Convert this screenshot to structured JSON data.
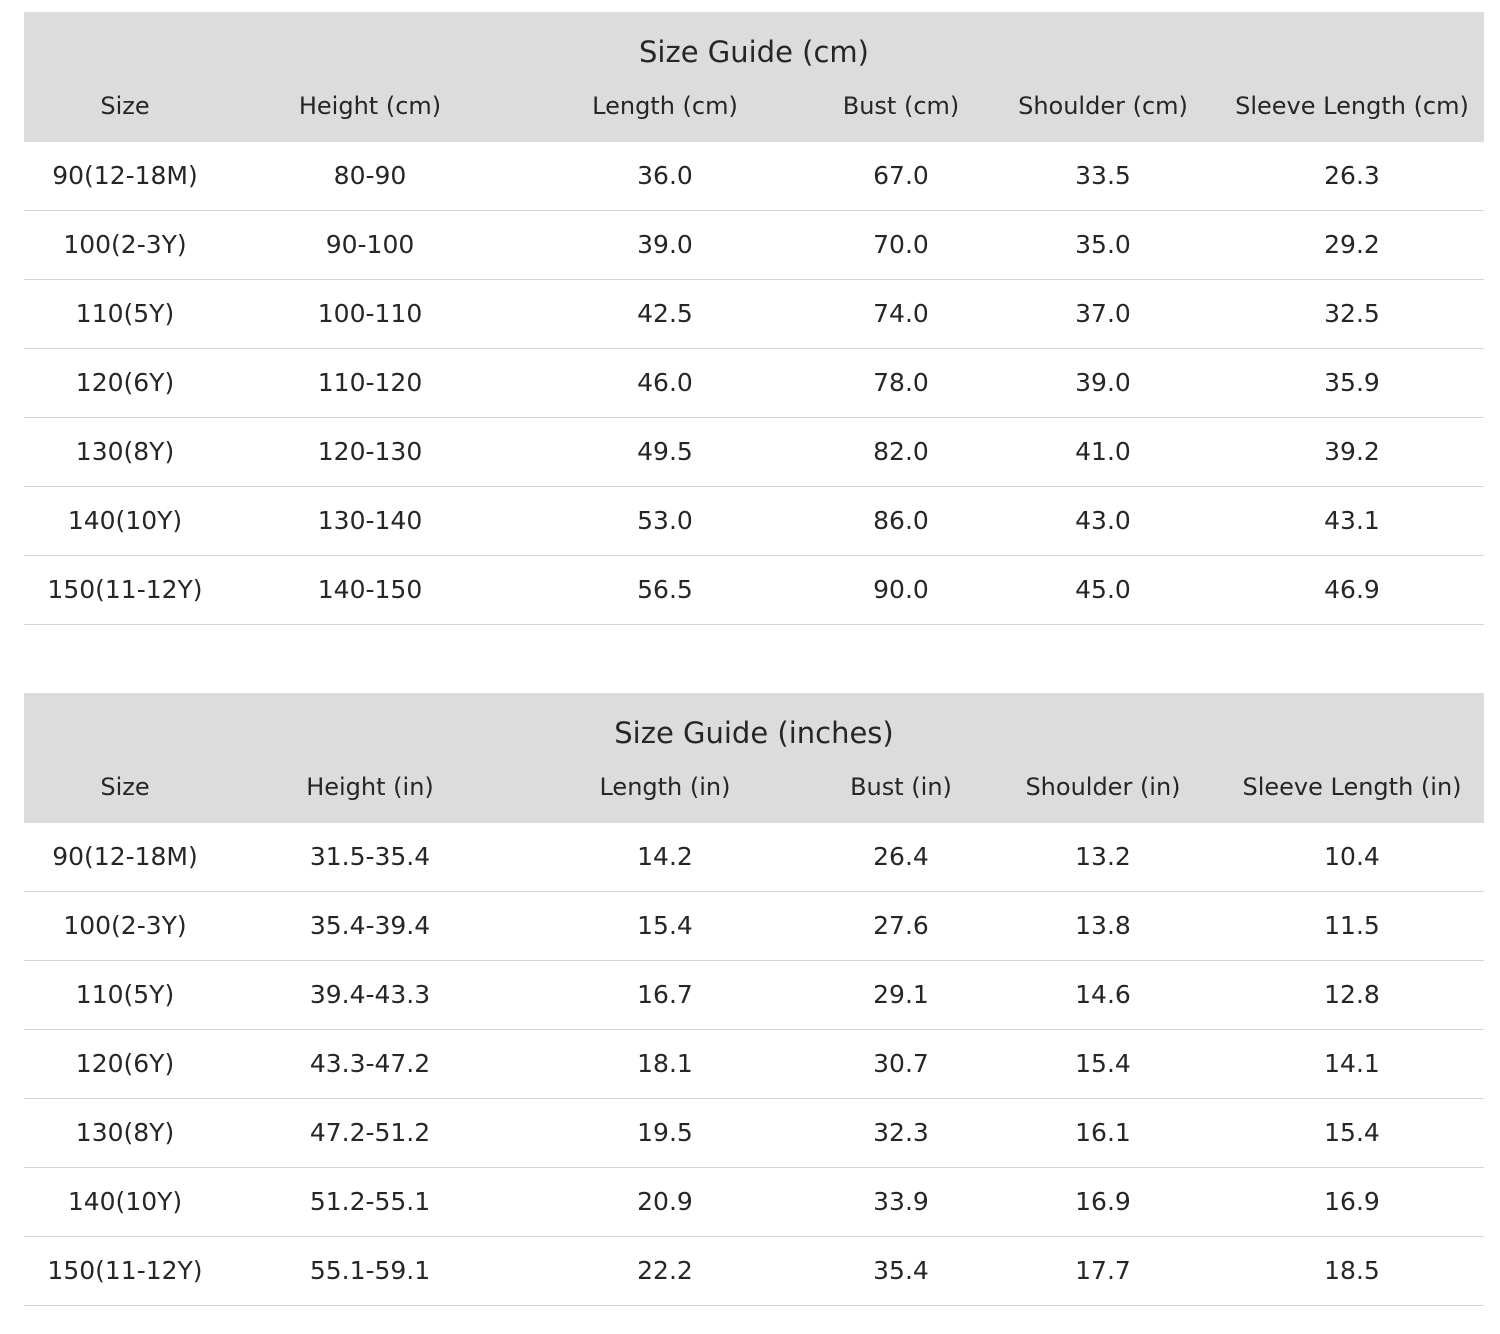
{
  "tables": [
    {
      "title": "Size Guide (cm)",
      "columns": [
        "Size",
        "Height (cm)",
        "Length (cm)",
        "Bust (cm)",
        "Shoulder (cm)",
        "Sleeve Length (cm)"
      ],
      "rows": [
        [
          "90(12-18M)",
          "80-90",
          "36.0",
          "67.0",
          "33.5",
          "26.3"
        ],
        [
          "100(2-3Y)",
          "90-100",
          "39.0",
          "70.0",
          "35.0",
          "29.2"
        ],
        [
          "110(5Y)",
          "100-110",
          "42.5",
          "74.0",
          "37.0",
          "32.5"
        ],
        [
          "120(6Y)",
          "110-120",
          "46.0",
          "78.0",
          "39.0",
          "35.9"
        ],
        [
          "130(8Y)",
          "120-130",
          "49.5",
          "82.0",
          "41.0",
          "39.2"
        ],
        [
          "140(10Y)",
          "130-140",
          "53.0",
          "86.0",
          "43.0",
          "43.1"
        ],
        [
          "150(11-12Y)",
          "140-150",
          "56.5",
          "90.0",
          "45.0",
          "46.9"
        ]
      ]
    },
    {
      "title": "Size Guide (inches)",
      "columns": [
        "Size",
        "Height (in)",
        "Length (in)",
        "Bust (in)",
        "Shoulder (in)",
        "Sleeve Length (in)"
      ],
      "rows": [
        [
          "90(12-18M)",
          "31.5-35.4",
          "14.2",
          "26.4",
          "13.2",
          "10.4"
        ],
        [
          "100(2-3Y)",
          "35.4-39.4",
          "15.4",
          "27.6",
          "13.8",
          "11.5"
        ],
        [
          "110(5Y)",
          "39.4-43.3",
          "16.7",
          "29.1",
          "14.6",
          "12.8"
        ],
        [
          "120(6Y)",
          "43.3-47.2",
          "18.1",
          "30.7",
          "15.4",
          "14.1"
        ],
        [
          "130(8Y)",
          "47.2-51.2",
          "19.5",
          "32.3",
          "16.1",
          "15.4"
        ],
        [
          "140(10Y)",
          "51.2-55.1",
          "20.9",
          "33.9",
          "16.9",
          "16.9"
        ],
        [
          "150(11-12Y)",
          "55.1-59.1",
          "22.2",
          "35.4",
          "17.7",
          "18.5"
        ]
      ]
    }
  ],
  "colors": {
    "header_background": "#dcdcdc",
    "row_divider": "#d4d4d4",
    "text": "#262626"
  }
}
